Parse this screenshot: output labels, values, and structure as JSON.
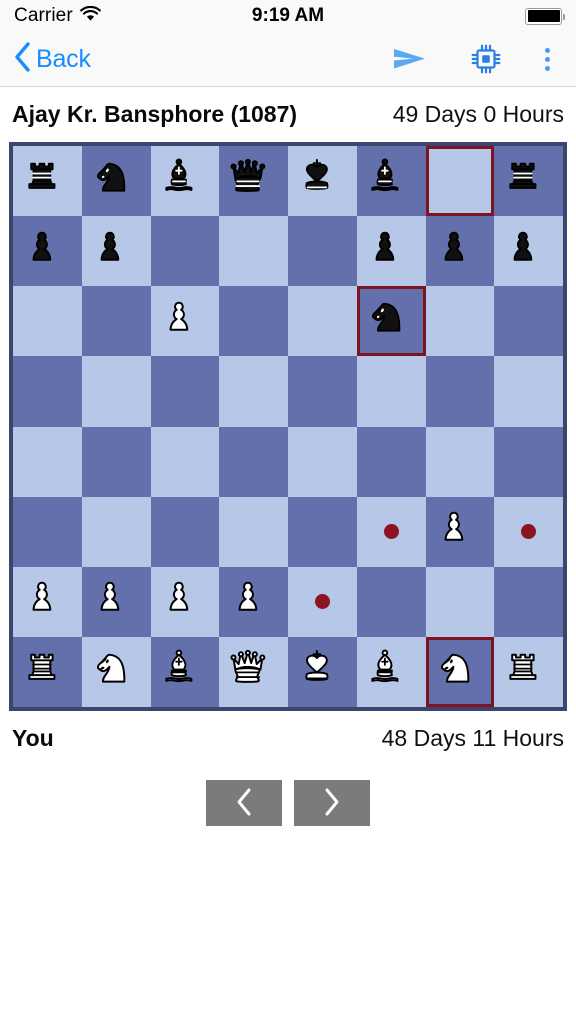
{
  "status_bar": {
    "carrier": "Carrier",
    "wifi_icon": "wifi-icon",
    "time": "9:19 AM",
    "battery_icon": "battery-full-icon"
  },
  "nav_bar": {
    "back_icon": "chevron-left-icon",
    "back_label": "Back",
    "send_icon": "send-arrow-icon",
    "engine_icon": "cpu-chip-icon",
    "menu_icon": "more-vertical-icon",
    "accent_color": "#1a8cff",
    "icon_color_send": "#5aa9f2",
    "icon_color_engine": "#2a7fe0"
  },
  "opponent": {
    "name": "Ajay Kr. Bansphore (1087)",
    "clock": "49 Days 0 Hours"
  },
  "you": {
    "name": "You",
    "clock": "48 Days 11 Hours"
  },
  "controls": {
    "prev_icon": "chevron-left-icon",
    "next_icon": "chevron-right-icon",
    "button_color": "#7b7b7b"
  },
  "board": {
    "light_square_color": "#b7c7e8",
    "dark_square_color": "#6370ab",
    "border_color": "#3c4470",
    "highlight_color": "#7d1422",
    "move_dot_color": "#8b1420",
    "orientation": "white-bottom",
    "files": [
      "a",
      "b",
      "c",
      "d",
      "e",
      "f",
      "g",
      "h"
    ],
    "ranks": [
      8,
      7,
      6,
      5,
      4,
      3,
      2,
      1
    ],
    "squares": [
      [
        {
          "id": "a8",
          "piece": "black-rook",
          "highlight": false,
          "dot": false
        },
        {
          "id": "b8",
          "piece": "black-knight",
          "highlight": false,
          "dot": false
        },
        {
          "id": "c8",
          "piece": "black-bishop",
          "highlight": false,
          "dot": false
        },
        {
          "id": "d8",
          "piece": "black-queen",
          "highlight": false,
          "dot": false
        },
        {
          "id": "e8",
          "piece": "black-king",
          "highlight": false,
          "dot": false
        },
        {
          "id": "f8",
          "piece": "black-bishop",
          "highlight": false,
          "dot": false
        },
        {
          "id": "g8",
          "piece": null,
          "highlight": true,
          "dot": false
        },
        {
          "id": "h8",
          "piece": "black-rook",
          "highlight": false,
          "dot": false
        }
      ],
      [
        {
          "id": "a7",
          "piece": "black-pawn",
          "highlight": false,
          "dot": false
        },
        {
          "id": "b7",
          "piece": "black-pawn",
          "highlight": false,
          "dot": false
        },
        {
          "id": "c7",
          "piece": null,
          "highlight": false,
          "dot": false
        },
        {
          "id": "d7",
          "piece": null,
          "highlight": false,
          "dot": false
        },
        {
          "id": "e7",
          "piece": null,
          "highlight": false,
          "dot": false
        },
        {
          "id": "f7",
          "piece": "black-pawn",
          "highlight": false,
          "dot": false
        },
        {
          "id": "g7",
          "piece": "black-pawn",
          "highlight": false,
          "dot": false
        },
        {
          "id": "h7",
          "piece": "black-pawn",
          "highlight": false,
          "dot": false
        }
      ],
      [
        {
          "id": "a6",
          "piece": null,
          "highlight": false,
          "dot": false
        },
        {
          "id": "b6",
          "piece": null,
          "highlight": false,
          "dot": false
        },
        {
          "id": "c6",
          "piece": "white-pawn",
          "highlight": false,
          "dot": false
        },
        {
          "id": "d6",
          "piece": null,
          "highlight": false,
          "dot": false
        },
        {
          "id": "e6",
          "piece": null,
          "highlight": false,
          "dot": false
        },
        {
          "id": "f6",
          "piece": "black-knight",
          "highlight": true,
          "dot": false
        },
        {
          "id": "g6",
          "piece": null,
          "highlight": false,
          "dot": false
        },
        {
          "id": "h6",
          "piece": null,
          "highlight": false,
          "dot": false
        }
      ],
      [
        {
          "id": "a5",
          "piece": null,
          "highlight": false,
          "dot": false
        },
        {
          "id": "b5",
          "piece": null,
          "highlight": false,
          "dot": false
        },
        {
          "id": "c5",
          "piece": null,
          "highlight": false,
          "dot": false
        },
        {
          "id": "d5",
          "piece": null,
          "highlight": false,
          "dot": false
        },
        {
          "id": "e5",
          "piece": null,
          "highlight": false,
          "dot": false
        },
        {
          "id": "f5",
          "piece": null,
          "highlight": false,
          "dot": false
        },
        {
          "id": "g5",
          "piece": null,
          "highlight": false,
          "dot": false
        },
        {
          "id": "h5",
          "piece": null,
          "highlight": false,
          "dot": false
        }
      ],
      [
        {
          "id": "a4",
          "piece": null,
          "highlight": false,
          "dot": false
        },
        {
          "id": "b4",
          "piece": null,
          "highlight": false,
          "dot": false
        },
        {
          "id": "c4",
          "piece": null,
          "highlight": false,
          "dot": false
        },
        {
          "id": "d4",
          "piece": null,
          "highlight": false,
          "dot": false
        },
        {
          "id": "e4",
          "piece": null,
          "highlight": false,
          "dot": false
        },
        {
          "id": "f4",
          "piece": null,
          "highlight": false,
          "dot": false
        },
        {
          "id": "g4",
          "piece": null,
          "highlight": false,
          "dot": false
        },
        {
          "id": "h4",
          "piece": null,
          "highlight": false,
          "dot": false
        }
      ],
      [
        {
          "id": "a3",
          "piece": null,
          "highlight": false,
          "dot": false
        },
        {
          "id": "b3",
          "piece": null,
          "highlight": false,
          "dot": false
        },
        {
          "id": "c3",
          "piece": null,
          "highlight": false,
          "dot": false
        },
        {
          "id": "d3",
          "piece": null,
          "highlight": false,
          "dot": false
        },
        {
          "id": "e3",
          "piece": null,
          "highlight": false,
          "dot": false
        },
        {
          "id": "f3",
          "piece": null,
          "highlight": false,
          "dot": true
        },
        {
          "id": "g3",
          "piece": "white-pawn",
          "highlight": false,
          "dot": false
        },
        {
          "id": "h3",
          "piece": null,
          "highlight": false,
          "dot": true
        }
      ],
      [
        {
          "id": "a2",
          "piece": "white-pawn",
          "highlight": false,
          "dot": false
        },
        {
          "id": "b2",
          "piece": "white-pawn",
          "highlight": false,
          "dot": false
        },
        {
          "id": "c2",
          "piece": "white-pawn",
          "highlight": false,
          "dot": false
        },
        {
          "id": "d2",
          "piece": "white-pawn",
          "highlight": false,
          "dot": false
        },
        {
          "id": "e2",
          "piece": null,
          "highlight": false,
          "dot": true
        },
        {
          "id": "f2",
          "piece": null,
          "highlight": false,
          "dot": false
        },
        {
          "id": "g2",
          "piece": null,
          "highlight": false,
          "dot": false
        },
        {
          "id": "h2",
          "piece": null,
          "highlight": false,
          "dot": false
        }
      ],
      [
        {
          "id": "a1",
          "piece": "white-rook",
          "highlight": false,
          "dot": false
        },
        {
          "id": "b1",
          "piece": "white-knight",
          "highlight": false,
          "dot": false
        },
        {
          "id": "c1",
          "piece": "white-bishop",
          "highlight": false,
          "dot": false
        },
        {
          "id": "d1",
          "piece": "white-queen",
          "highlight": false,
          "dot": false
        },
        {
          "id": "e1",
          "piece": "white-king",
          "highlight": false,
          "dot": false
        },
        {
          "id": "f1",
          "piece": "white-bishop",
          "highlight": false,
          "dot": false
        },
        {
          "id": "g1",
          "piece": "white-knight",
          "highlight": true,
          "dot": false
        },
        {
          "id": "h1",
          "piece": "white-rook",
          "highlight": false,
          "dot": false
        }
      ]
    ]
  }
}
